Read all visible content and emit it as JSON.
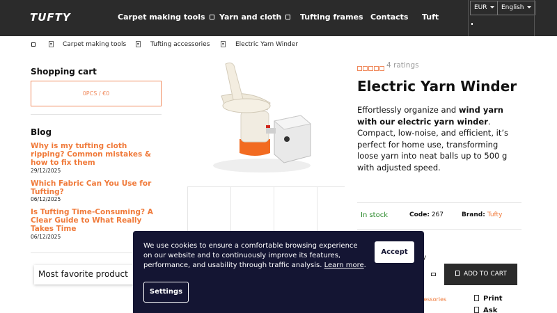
{
  "header": {
    "logo": "TUFTY",
    "nav": [
      {
        "label": "Carpet making tools"
      },
      {
        "label": "Yarn and cloth"
      },
      {
        "label": "Tufting frames"
      },
      {
        "label": "Contacts"
      },
      {
        "label": "Tuft"
      }
    ],
    "currency": "EUR",
    "language": "English"
  },
  "breadcrumb": [
    "Carpet making tools",
    "Tufting accessories",
    "Electric Yarn Winder"
  ],
  "sidebar": {
    "cart_heading": "Shopping cart",
    "cart_summary": "0PCS / €0",
    "blog_heading": "Blog",
    "posts": [
      {
        "title": "Why is my tufting cloth ripping? Common mistakes & how to fix them",
        "date": "29/12/2025"
      },
      {
        "title": "Which Fabric Can You Use for Tufting?",
        "date": "06/12/2025"
      },
      {
        "title": "Is Tufting Time-Consuming? A Clear Guide to What Really Takes Time",
        "date": "06/12/2025"
      }
    ],
    "favorite_label": "Most favorite product"
  },
  "product": {
    "rating_text": "4 ratings",
    "stars_total": 5,
    "title": "Electric Yarn Winder",
    "desc_part1": "Effortlessly organize and ",
    "desc_bold": "wind yarn with our electric yarn winder",
    "desc_part2": ". Compact, low-noise, and efficient, it’s perfect for home use, transforming loose yarn into neat balls up to 500 g with adjusted speed.",
    "stock": "In stock",
    "code_label": "Code:",
    "code_value": "267",
    "brand_label": "Brand:",
    "brand_value": "Tufty",
    "quantity_fragment": "ery",
    "add_to_cart": "ADD TO CART",
    "accessories_fragment": "cessories",
    "print_label": "Print",
    "ask_label": "Ask"
  },
  "cookie": {
    "text": "We use cookies to ensure a comfortable browsing experience on our website and to continuously improve its features, performance, and usability through traffic analysis.",
    "link": "Learn more",
    "accept": "Accept",
    "settings": "Settings"
  },
  "colors": {
    "accent": "#f07a3a",
    "header_bg": "#2b2b2b",
    "cookie_bg": "#141533",
    "stock_green": "#2e8b2e"
  }
}
